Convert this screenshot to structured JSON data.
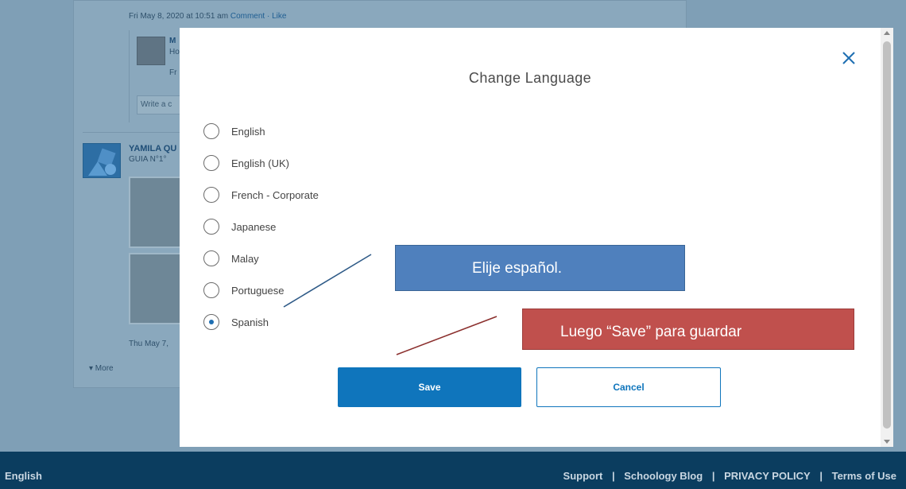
{
  "background": {
    "post_meta": "Fri May 8, 2020 at 10:51 am",
    "post_actions": "Comment · Like",
    "comment_name": "M",
    "comment_sub": "Ho",
    "comment_sub2": "Fr",
    "write_placeholder": "Write a c",
    "author_name": "YAMILA QU",
    "author_sub": "GUIA N°1°",
    "post_date": "Thu May 7,",
    "more_label": "▾ More"
  },
  "modal": {
    "title": "Change Language",
    "close_icon": "close-icon",
    "languages": [
      {
        "label": "English",
        "selected": false
      },
      {
        "label": "English (UK)",
        "selected": false
      },
      {
        "label": "French - Corporate",
        "selected": false
      },
      {
        "label": "Japanese",
        "selected": false
      },
      {
        "label": "Malay",
        "selected": false
      },
      {
        "label": "Portuguese",
        "selected": false
      },
      {
        "label": "Spanish",
        "selected": true
      }
    ],
    "save_label": "Save",
    "cancel_label": "Cancel"
  },
  "annotations": {
    "blue_text": "Elije español.",
    "red_text": "Luego “Save” para guardar"
  },
  "footer": {
    "language": "English",
    "links": [
      "Support",
      "Schoology Blog",
      "PRIVACY POLICY",
      "Terms of Use"
    ],
    "separator": "|"
  },
  "colors": {
    "accent": "#0f75bc",
    "footer_bg": "#0b3d5f",
    "callout_blue": "#4f80bd",
    "callout_red": "#c0504d"
  }
}
